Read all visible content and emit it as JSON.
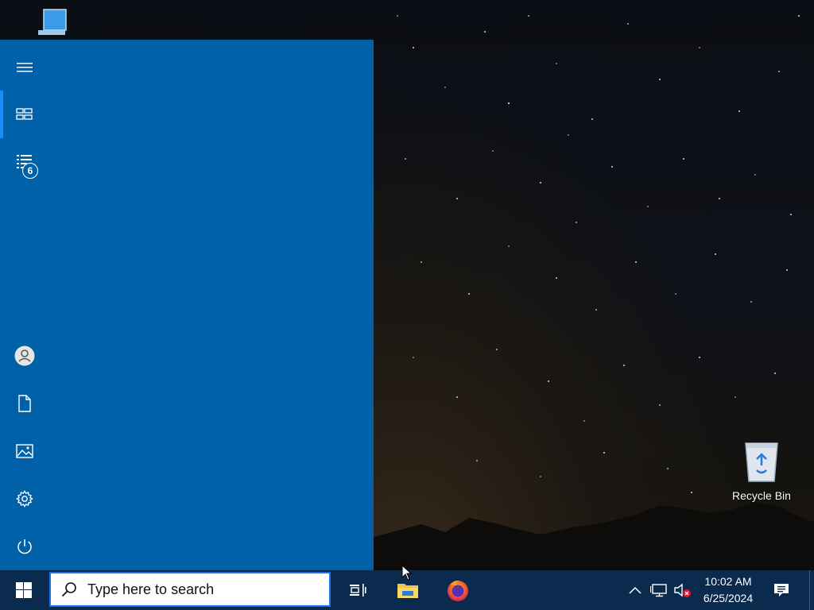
{
  "desktop": {
    "icons": [
      {
        "name": "this-pc",
        "label": ""
      },
      {
        "name": "recycle-bin",
        "label": "Recycle Bin"
      }
    ]
  },
  "start_menu": {
    "rail_items": [
      {
        "id": "expand",
        "icon": "hamburger-icon"
      },
      {
        "id": "tiles",
        "icon": "tiles-icon",
        "active": true
      },
      {
        "id": "all-apps",
        "icon": "list-icon",
        "badge": "6"
      },
      {
        "id": "account",
        "icon": "user-icon"
      },
      {
        "id": "documents",
        "icon": "document-icon"
      },
      {
        "id": "pictures",
        "icon": "pictures-icon"
      },
      {
        "id": "settings",
        "icon": "gear-icon"
      },
      {
        "id": "power",
        "icon": "power-icon"
      }
    ],
    "background": "#0060a8",
    "accent": "#1a8cff"
  },
  "taskbar": {
    "search_placeholder": "Type here to search",
    "apps": [
      "task-view",
      "file-explorer",
      "firefox"
    ],
    "clock": {
      "time": "10:02 AM",
      "date": "6/25/2024"
    },
    "tray": [
      "show-hidden-icons",
      "network-icon",
      "volume-muted-icon",
      "action-center-icon"
    ]
  }
}
